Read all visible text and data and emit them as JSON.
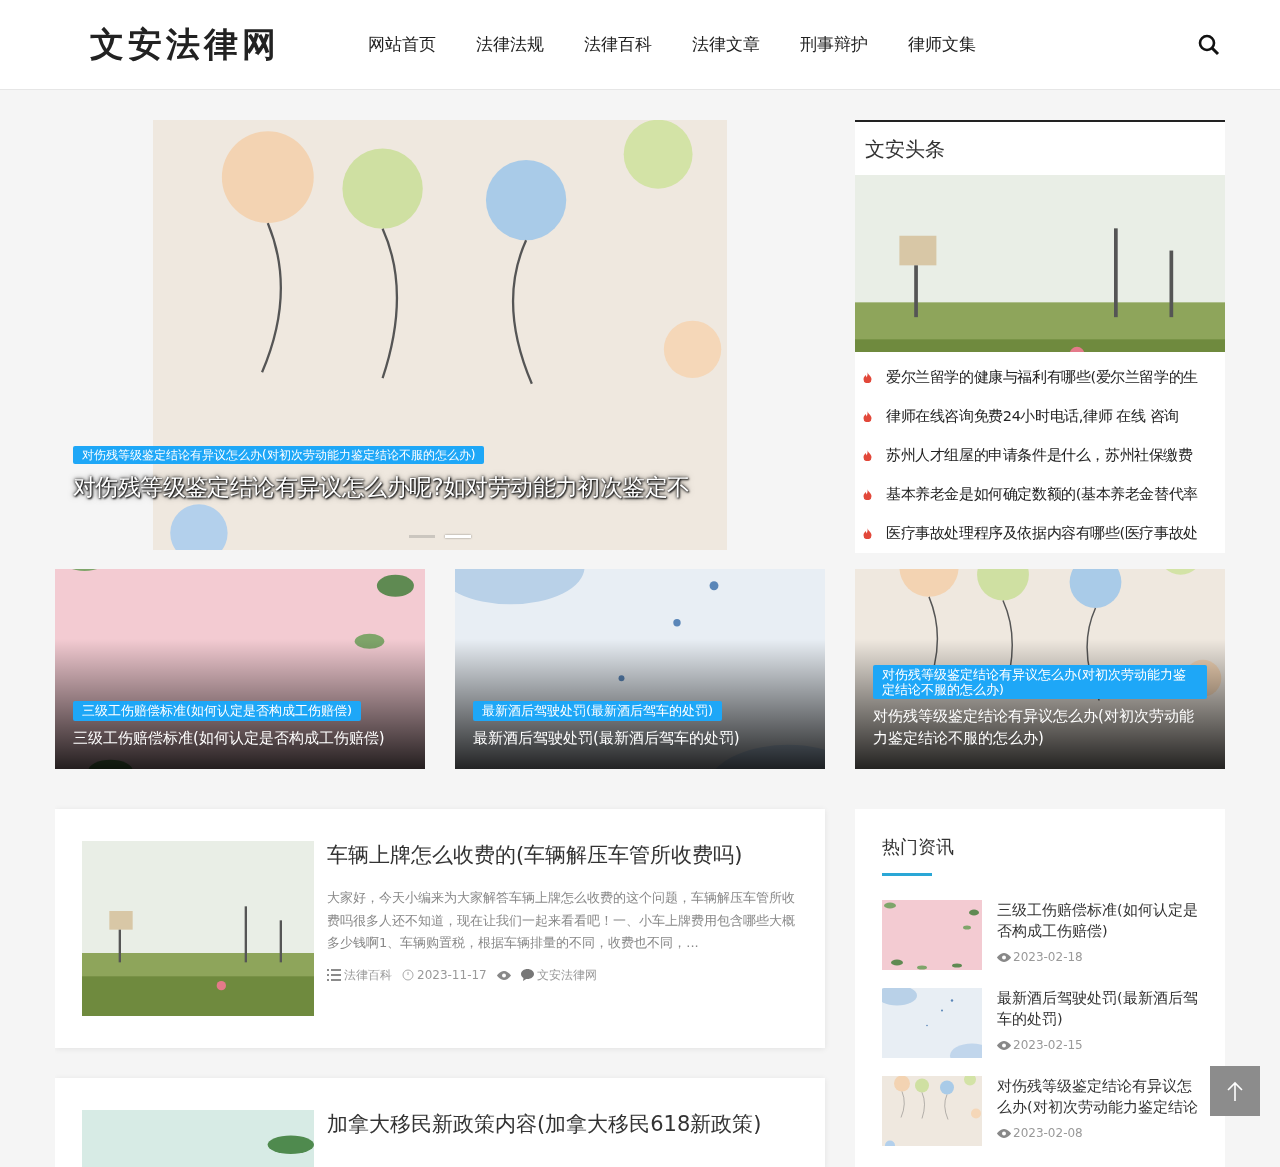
{
  "header": {
    "logo": "文安法律网",
    "nav": [
      "网站首页",
      "法律法规",
      "法律百科",
      "法律文章",
      "刑事辩护",
      "律师文集"
    ]
  },
  "slider": {
    "badge": "对伤残等级鉴定结论有异议怎么办(对初次劳动能力鉴定结论不服的怎么办)",
    "title": "对伤残等级鉴定结论有异议怎么办呢?如对劳动能力初次鉴定不",
    "dots": [
      {
        "selected": false
      },
      {
        "selected": true
      }
    ]
  },
  "headlines": {
    "title": "文安头条",
    "items": [
      "爱尔兰留学的健康与福利有哪些(爱尔兰留学的生",
      "律师在线咨询免费24小时电话,律师 在线 咨询",
      "苏州人才组屋的申请条件是什么，苏州社保缴费",
      "基本养老金是如何确定数额的(基本养老金替代率",
      "医疗事故处理程序及依据内容有哪些(医疗事故处"
    ]
  },
  "features": [
    {
      "badge": "三级工伤赔偿标准(如何认定是否构成工伤赔偿)",
      "title": "三级工伤赔偿标准(如何认定是否构成工伤赔偿)"
    },
    {
      "badge": "最新酒后驾驶处罚(最新酒后驾车的处罚)",
      "title": "最新酒后驾驶处罚(最新酒后驾车的处罚)"
    },
    {
      "badge": "对伤残等级鉴定结论有异议怎么办(对初次劳动能力鉴定结论不服的怎么办)",
      "title": "对伤残等级鉴定结论有异议怎么办(对初次劳动能力鉴定结论不服的怎么办)"
    }
  ],
  "articles": [
    {
      "title": "车辆上牌怎么收费的(车辆解压车管所收费吗)",
      "excerpt": "大家好，今天小编来为大家解答车辆上牌怎么收费的这个问题，车辆解压车管所收费吗很多人还不知道，现在让我们一起来看看吧！一、小车上牌费用包含哪些大概多少钱啊1、车辆购置税，根据车辆排量的不同，收费也不同，...",
      "category": "法律百科",
      "date": "2023-11-17",
      "author": "文安法律网"
    },
    {
      "title": "加拿大移民新政策内容(加拿大移民618新政策)"
    }
  ],
  "hot": {
    "title": "热门资讯",
    "items": [
      {
        "title": "三级工伤赔偿标准(如何认定是否构成工伤赔偿)",
        "date": "2023-02-18"
      },
      {
        "title": "最新酒后驾驶处罚(最新酒后驾车的处罚)",
        "date": "2023-02-15"
      },
      {
        "title": "对伤残等级鉴定结论有异议怎么办(对初次劳动能力鉴定结论",
        "date": "2023-02-08"
      }
    ]
  }
}
